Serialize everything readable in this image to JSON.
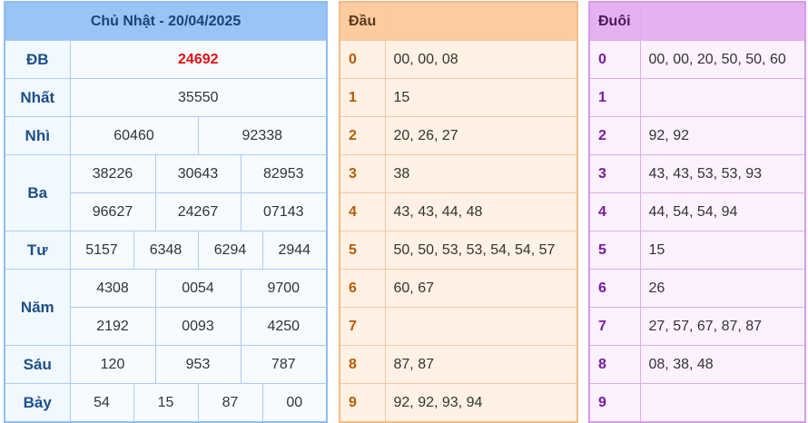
{
  "results": {
    "title": "Chủ Nhật - 20/04/2025",
    "rows": [
      {
        "label": "ĐB",
        "values": [
          "24692"
        ]
      },
      {
        "label": "Nhất",
        "values": [
          "35550"
        ]
      },
      {
        "label": "Nhì",
        "values": [
          "60460",
          "92338"
        ]
      },
      {
        "label": "Ba",
        "values": [
          "38226",
          "30643",
          "82953",
          "96627",
          "24267",
          "07143"
        ]
      },
      {
        "label": "Tư",
        "values": [
          "5157",
          "6348",
          "6294",
          "2944"
        ]
      },
      {
        "label": "Năm",
        "values": [
          "4308",
          "0054",
          "9700",
          "2192",
          "0093",
          "4250"
        ]
      },
      {
        "label": "Sáu",
        "values": [
          "120",
          "953",
          "787"
        ]
      },
      {
        "label": "Bảy",
        "values": [
          "54",
          "15",
          "87",
          "00"
        ]
      }
    ],
    "special_color": "#e01010"
  },
  "dau": {
    "header": "Đầu",
    "rows": [
      {
        "key": "0",
        "values": "00, 00, 08"
      },
      {
        "key": "1",
        "values": "15"
      },
      {
        "key": "2",
        "values": "20, 26, 27"
      },
      {
        "key": "3",
        "values": "38"
      },
      {
        "key": "4",
        "values": "43, 43, 44, 48"
      },
      {
        "key": "5",
        "values": "50, 50, 53, 53, 54, 54, 57"
      },
      {
        "key": "6",
        "values": "60, 67"
      },
      {
        "key": "7",
        "values": ""
      },
      {
        "key": "8",
        "values": "87, 87"
      },
      {
        "key": "9",
        "values": "92, 92, 93, 94"
      }
    ]
  },
  "duoi": {
    "header": "Đuôi",
    "rows": [
      {
        "key": "0",
        "values": "00, 00, 20, 50, 50, 60"
      },
      {
        "key": "1",
        "values": ""
      },
      {
        "key": "2",
        "values": "92, 92"
      },
      {
        "key": "3",
        "values": "43, 43, 53, 53, 93"
      },
      {
        "key": "4",
        "values": "44, 54, 54, 94"
      },
      {
        "key": "5",
        "values": "15"
      },
      {
        "key": "6",
        "values": "26"
      },
      {
        "key": "7",
        "values": "27, 57, 67, 87, 87"
      },
      {
        "key": "8",
        "values": "08, 38, 48"
      },
      {
        "key": "9",
        "values": ""
      }
    ]
  }
}
